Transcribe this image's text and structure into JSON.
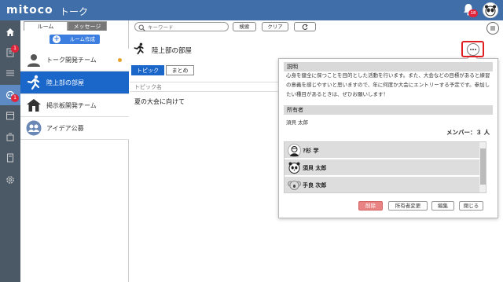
{
  "header": {
    "logo": "mitoco",
    "title": "トーク",
    "notification_count": "18"
  },
  "rail": {
    "badges": [
      "1",
      "1"
    ]
  },
  "room_panel": {
    "tabs": [
      "ルーム",
      "メッセージ"
    ],
    "create_label": "ルーム作成",
    "rooms": [
      {
        "label": "トーク開発チーム",
        "unread": true
      },
      {
        "label": "陸上部の部屋",
        "selected": true
      },
      {
        "label": "掲示板開発チーム"
      },
      {
        "label": "アイデア公募"
      }
    ]
  },
  "search": {
    "placeholder": "キーワード",
    "search_label": "検索",
    "clear_label": "クリア"
  },
  "room": {
    "title": "陸上部の部屋",
    "tabs": [
      "トピック",
      "まとめ"
    ],
    "topic_header": "トピック名",
    "topics": [
      "夏の大会に向けて"
    ]
  },
  "popover": {
    "desc_title": "説明",
    "description": "心身を健全に保つことを目的とした活動を行います。また、大会などの目標があると練習の意義を感じやすいと思いますので、年に何度か大会にエントリーする予定です。参加したい種目があるときは、ぜひお願いします！",
    "owner_title": "所有者",
    "owner": "須貝 太郎",
    "members_label": "メンバー：３ 人",
    "members": [
      "?杉 学",
      "須貝 太郎",
      "手良 次郎"
    ],
    "buttons": {
      "delete": "削除",
      "change_owner": "所有者変更",
      "edit": "編集",
      "close": "閉じる"
    }
  },
  "colors": {
    "header": "#3f6ea8",
    "accent": "#1a66c9",
    "rail": "#4b5866",
    "badge": "#e0243a",
    "highlight": "#e02020"
  }
}
